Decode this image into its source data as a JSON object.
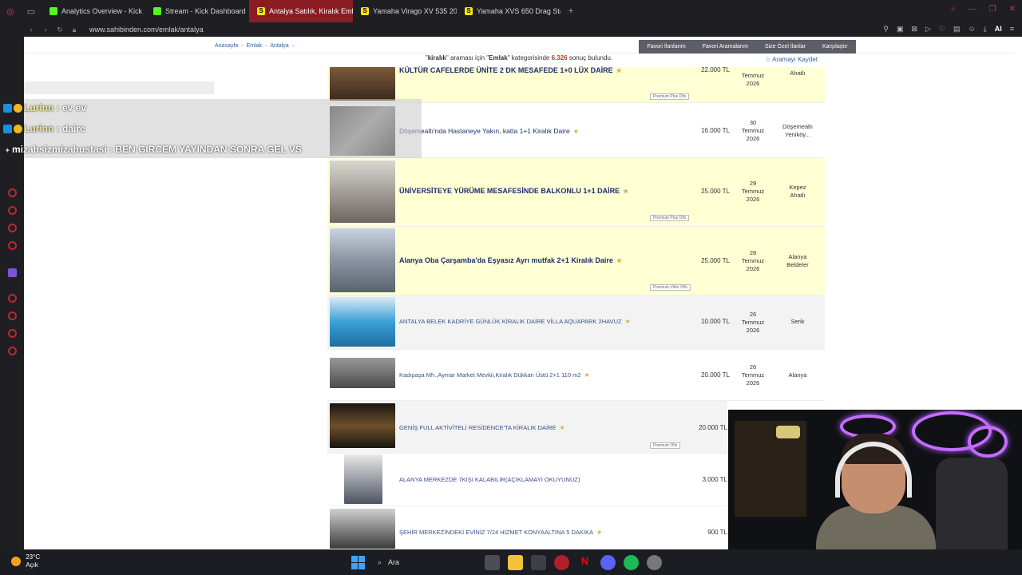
{
  "browser": {
    "tabs": [
      {
        "label": "Analytics Overview - Kick",
        "icon": "kick-icon",
        "active": false
      },
      {
        "label": "Stream - Kick Dashboard",
        "icon": "kick-icon",
        "active": false
      },
      {
        "label": "Antalya Satılık, Kiralık Emla",
        "icon": "sahibinden-icon",
        "active": true
      },
      {
        "label": "Yamaha Virago XV 535 20",
        "icon": "sahibinden-icon",
        "active": false
      },
      {
        "label": "Yamaha XVS 650 Drag Sta",
        "icon": "sahibinden-icon",
        "active": false
      }
    ],
    "new_tab": "+",
    "url": "www.sahibinden.com/emlak/antalya",
    "ai_label": "AI"
  },
  "site": {
    "breadcrumbs": [
      "Anasayfa",
      "Emlak",
      "Antalya"
    ],
    "nav": [
      "Favori İlanlarım",
      "Favori Aramalarım",
      "Size Özel İlanlar",
      "Karşılaştır"
    ],
    "result": {
      "query": "kiralık",
      "pre": "\"",
      "mid": "\" araması için \"",
      "category": "Emlak",
      "mid2": "\" kategorisinde ",
      "count": "6.326",
      "post": " sonuç bulundu."
    },
    "save_search": "☆ Aramayı Kaydet"
  },
  "listings": [
    {
      "title": "KÜLTÜR CAFELERDE ÜNİTE 2 DK MESAFEDE 1+0 LÜX DAİRE",
      "price": "22.000 TL",
      "date": "Temmuz 2026",
      "date_top": "",
      "loc": "Ahatlı",
      "loc2": "",
      "badge": "Premium Plus Ofis"
    },
    {
      "title": "Döşemealtı'nda Hastaneye Yakın, katta 1+1 Kiralık Daire",
      "price": "16.000 TL",
      "date_top": "30",
      "date": "Temmuz 2026",
      "loc": "Döşemealtı",
      "loc2": "Yeniköy...",
      "badge": ""
    },
    {
      "title": "ÜNİVERSİTEYE YÜRÜME MESAFESİNDE BALKONLU 1+1 DAİRE",
      "price": "25.000 TL",
      "date_top": "29",
      "date": "Temmuz 2026",
      "loc": "Kepez",
      "loc2": "Ahatlı",
      "badge": "Premium Plus Ofis"
    },
    {
      "title": "Alanya Oba Çarşamba'da Eşyasız Ayrı mutfak 2+1 Kiralık Daire",
      "price": "25.000 TL",
      "date_top": "28",
      "date": "Temmuz 2026",
      "loc": "Alanya",
      "loc2": "Beldeler",
      "badge": "Premium Vitrin Ofis"
    },
    {
      "title": "ANTALYA BELEK KADRİYE GÜNLÜK KİRALIK DAİRE VİLLA AQUAPARK 2HAVUZ",
      "price": "10.000 TL",
      "date_top": "26",
      "date": "Temmuz 2026",
      "loc": "Serik",
      "loc2": "",
      "badge": ""
    },
    {
      "title": "Kadıpaşa Mh.,Aymar Market Mevkii,Kiralık Dükkan Üstü 2+1 110 m2",
      "price": "20.000 TL",
      "date_top": "26",
      "date": "Temmuz 2026",
      "loc": "Alanya",
      "loc2": "",
      "badge": ""
    },
    {
      "title": "GENİŞ FULL AKTİVİTELİ RESİDENCE'TA KİRALIK DAİRE",
      "price": "20.000 TL",
      "date_top": "",
      "date": "",
      "loc": "",
      "loc2": "",
      "badge": "Premium Ofis"
    },
    {
      "title": "ALANYA MERKEZDE 7KIŞI KALABILIR(AÇIKLAMAYI OKUYUNUZ)",
      "price": "3.000 TL",
      "date_top": "",
      "date": "",
      "loc": "",
      "loc2": "",
      "badge": ""
    },
    {
      "title": "ŞEHİR MERKEZİNDEKİ EVİNİZ 7/24 HİZMET KONYAALTINA 5 DAKİKA",
      "price": "900 TL",
      "date_top": "",
      "date": "",
      "loc": "",
      "loc2": "",
      "badge": ""
    }
  ],
  "chat": [
    {
      "user": "Lurinn",
      "message": " : ev ev"
    },
    {
      "user": "Lurinn",
      "message": " : daire"
    },
    {
      "user": "mizahsizmizahustasi",
      "message": " : BEN GIRCEM YAYINDAN SONRA GEL VS"
    }
  ],
  "taskbar": {
    "temp": "23°C",
    "weather": "Açık",
    "search": "Ara"
  },
  "colors": {
    "premium_bg": "#ffffd4",
    "accent_red": "#c0392b",
    "link_blue": "#1e2f6e",
    "active_tab": "#8a1c24"
  }
}
